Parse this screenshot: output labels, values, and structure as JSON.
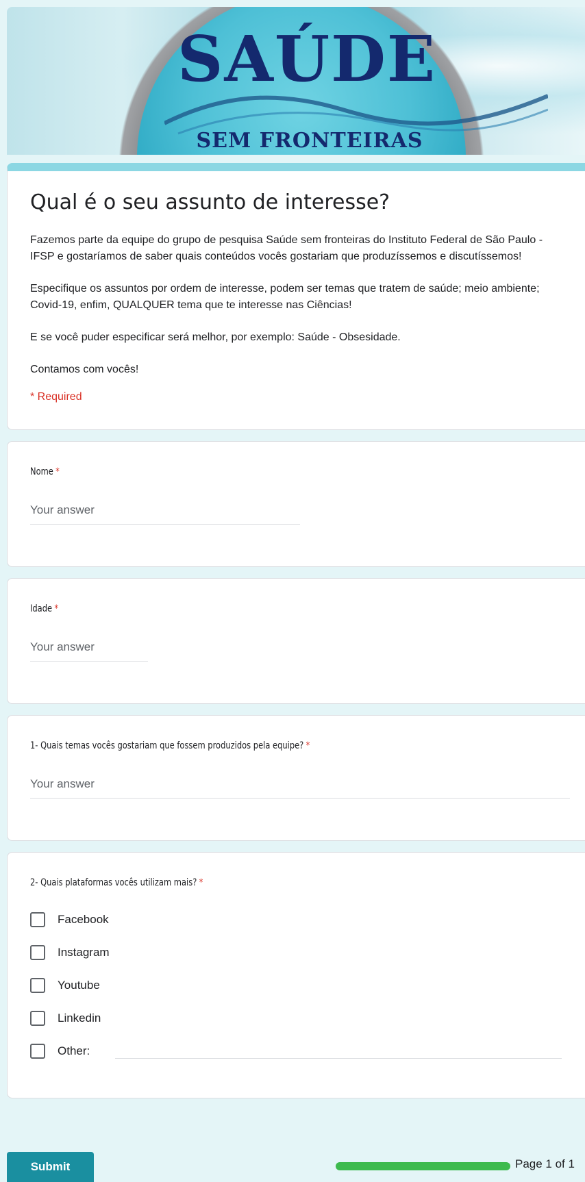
{
  "banner": {
    "title": "SAÚDE",
    "subtitle": "SEM FRONTEIRAS"
  },
  "form": {
    "title": "Qual é o seu assunto de interesse?",
    "description": [
      "Fazemos parte da equipe do grupo de pesquisa Saúde sem fronteiras do Instituto Federal de São Paulo - IFSP e gostaríamos de saber quais conteúdos vocês gostariam que produzíssemos e discutíssemos!",
      "Especifique os assuntos por ordem de interesse, podem ser temas que tratem de saúde; meio ambiente; Covid-19, enfim, QUALQUER tema que te interesse nas Ciências!",
      "E se você puder especificar será melhor, por exemplo: Saúde - Obsesidade.",
      "Contamos com vocês!"
    ],
    "required_note": "* Required"
  },
  "questions": {
    "nome": {
      "label": "Nome",
      "star": "*",
      "placeholder": "Your answer"
    },
    "idade": {
      "label": "Idade",
      "star": "*",
      "placeholder": "Your answer"
    },
    "temas": {
      "label": "1- Quais temas vocês gostariam que fossem produzidos pela equipe?",
      "star": "*",
      "placeholder": "Your answer"
    },
    "plataformas": {
      "label": "2- Quais plataformas vocês utilizam mais?",
      "star": "*",
      "options": [
        "Facebook",
        "Instagram",
        "Youtube",
        "Linkedin",
        "Other:"
      ]
    }
  },
  "footer": {
    "submit_label": "Submit",
    "page_indicator": "Page 1 of 1",
    "progress": 1.0
  },
  "colors": {
    "accent": "#8cd7e3",
    "submit": "#1a8fa0",
    "required": "#d93025",
    "progress": "#3dba4e"
  }
}
